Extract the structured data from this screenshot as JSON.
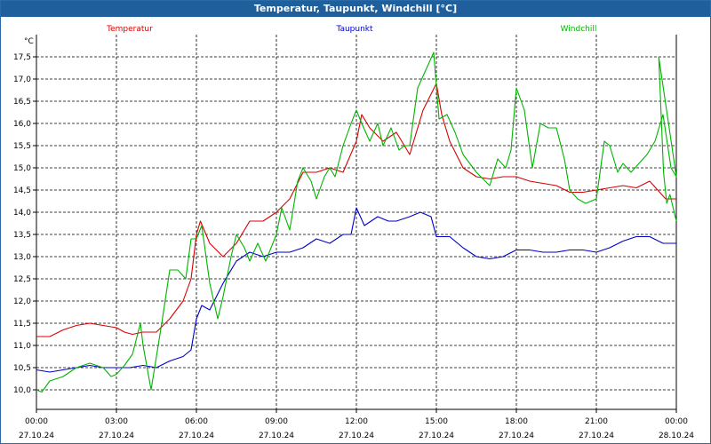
{
  "window": {
    "title": "Temperatur, Taupunkt, Windchill [°C]"
  },
  "chart_data": {
    "type": "line",
    "title": "Temperatur, Taupunkt, Windchill [°C]",
    "ylabel": "°C",
    "xlabel": "",
    "ylim": [
      9.6,
      18.0
    ],
    "xlim": [
      0,
      24
    ],
    "grid": true,
    "legend_placement": "top",
    "yticks": [
      10.0,
      10.5,
      11.0,
      11.5,
      12.0,
      12.5,
      13.0,
      13.5,
      14.0,
      14.5,
      15.0,
      15.5,
      16.0,
      16.5,
      17.0,
      17.5
    ],
    "ytick_labels": [
      "10,0",
      "10,5",
      "11,0",
      "11,5",
      "12,0",
      "12,5",
      "13,0",
      "13,5",
      "14,0",
      "14,5",
      "15,0",
      "15,5",
      "16,0",
      "16,5",
      "17,0",
      "17,5"
    ],
    "xticks": [
      {
        "x": 0,
        "time": "00:00",
        "date": "27.10.24"
      },
      {
        "x": 3,
        "time": "03:00",
        "date": "27.10.24"
      },
      {
        "x": 6,
        "time": "06:00",
        "date": "27.10.24"
      },
      {
        "x": 9,
        "time": "09:00",
        "date": "27.10.24"
      },
      {
        "x": 12,
        "time": "12:00",
        "date": "27.10.24"
      },
      {
        "x": 15,
        "time": "15:00",
        "date": "27.10.24"
      },
      {
        "x": 18,
        "time": "18:00",
        "date": "27.10.24"
      },
      {
        "x": 21,
        "time": "21:00",
        "date": "27.10.24"
      },
      {
        "x": 24,
        "time": "00:00",
        "date": "28.10.24"
      }
    ],
    "series": [
      {
        "name": "Temperatur",
        "color": "#d80000",
        "points": [
          [
            0,
            11.2
          ],
          [
            0.5,
            11.2
          ],
          [
            1,
            11.35
          ],
          [
            1.5,
            11.45
          ],
          [
            2,
            11.5
          ],
          [
            2.5,
            11.45
          ],
          [
            3,
            11.4
          ],
          [
            3.3,
            11.3
          ],
          [
            3.6,
            11.25
          ],
          [
            4,
            11.3
          ],
          [
            4.5,
            11.3
          ],
          [
            5,
            11.6
          ],
          [
            5.5,
            12.0
          ],
          [
            5.8,
            12.5
          ],
          [
            6,
            13.5
          ],
          [
            6.15,
            13.8
          ],
          [
            6.5,
            13.3
          ],
          [
            7,
            13.0
          ],
          [
            7.5,
            13.3
          ],
          [
            8,
            13.8
          ],
          [
            8.5,
            13.8
          ],
          [
            9,
            14.0
          ],
          [
            9.5,
            14.3
          ],
          [
            10,
            14.9
          ],
          [
            10.5,
            14.9
          ],
          [
            11,
            15.0
          ],
          [
            11.5,
            14.9
          ],
          [
            12,
            15.6
          ],
          [
            12.2,
            16.2
          ],
          [
            12.5,
            15.9
          ],
          [
            13,
            15.6
          ],
          [
            13.5,
            15.8
          ],
          [
            14,
            15.3
          ],
          [
            14.5,
            16.3
          ],
          [
            15,
            16.9
          ],
          [
            15.2,
            16.2
          ],
          [
            15.5,
            15.6
          ],
          [
            16,
            15.0
          ],
          [
            16.5,
            14.8
          ],
          [
            17,
            14.75
          ],
          [
            17.5,
            14.8
          ],
          [
            18,
            14.8
          ],
          [
            18.5,
            14.7
          ],
          [
            19,
            14.65
          ],
          [
            19.5,
            14.6
          ],
          [
            20,
            14.45
          ],
          [
            20.5,
            14.45
          ],
          [
            21,
            14.5
          ],
          [
            21.5,
            14.55
          ],
          [
            22,
            14.6
          ],
          [
            22.5,
            14.55
          ],
          [
            23,
            14.7
          ],
          [
            23.3,
            14.5
          ],
          [
            23.6,
            14.3
          ],
          [
            24,
            14.3
          ]
        ]
      },
      {
        "name": "Taupunkt",
        "color": "#0000c8",
        "points": [
          [
            0,
            10.45
          ],
          [
            0.5,
            10.4
          ],
          [
            1,
            10.45
          ],
          [
            1.5,
            10.5
          ],
          [
            2,
            10.55
          ],
          [
            2.5,
            10.5
          ],
          [
            3,
            10.5
          ],
          [
            3.5,
            10.5
          ],
          [
            4,
            10.55
          ],
          [
            4.5,
            10.5
          ],
          [
            5,
            10.65
          ],
          [
            5.5,
            10.75
          ],
          [
            5.8,
            10.9
          ],
          [
            6,
            11.6
          ],
          [
            6.2,
            11.9
          ],
          [
            6.5,
            11.8
          ],
          [
            7,
            12.4
          ],
          [
            7.5,
            12.9
          ],
          [
            8,
            13.1
          ],
          [
            8.5,
            13.0
          ],
          [
            9,
            13.1
          ],
          [
            9.5,
            13.1
          ],
          [
            10,
            13.2
          ],
          [
            10.5,
            13.4
          ],
          [
            11,
            13.3
          ],
          [
            11.5,
            13.5
          ],
          [
            11.8,
            13.5
          ],
          [
            12,
            14.1
          ],
          [
            12.3,
            13.7
          ],
          [
            12.8,
            13.9
          ],
          [
            13.2,
            13.8
          ],
          [
            13.5,
            13.8
          ],
          [
            14,
            13.9
          ],
          [
            14.4,
            14.0
          ],
          [
            14.8,
            13.9
          ],
          [
            15,
            13.45
          ],
          [
            15.5,
            13.45
          ],
          [
            16,
            13.2
          ],
          [
            16.5,
            13.0
          ],
          [
            17,
            12.95
          ],
          [
            17.5,
            13.0
          ],
          [
            18,
            13.15
          ],
          [
            18.5,
            13.15
          ],
          [
            19,
            13.1
          ],
          [
            19.5,
            13.1
          ],
          [
            20,
            13.15
          ],
          [
            20.5,
            13.15
          ],
          [
            21,
            13.1
          ],
          [
            21.5,
            13.2
          ],
          [
            22,
            13.35
          ],
          [
            22.5,
            13.45
          ],
          [
            23,
            13.45
          ],
          [
            23.5,
            13.3
          ],
          [
            24,
            13.3
          ]
        ]
      },
      {
        "name": "Windchill",
        "color": "#00b400",
        "points": [
          [
            0,
            10.0
          ],
          [
            0.2,
            9.95
          ],
          [
            0.5,
            10.2
          ],
          [
            1,
            10.3
          ],
          [
            1.5,
            10.5
          ],
          [
            2,
            10.6
          ],
          [
            2.5,
            10.5
          ],
          [
            2.8,
            10.3
          ],
          [
            3,
            10.35
          ],
          [
            3.3,
            10.55
          ],
          [
            3.6,
            10.8
          ],
          [
            3.9,
            11.5
          ],
          [
            4,
            11.0
          ],
          [
            4.3,
            10.0
          ],
          [
            4.7,
            11.5
          ],
          [
            5,
            12.7
          ],
          [
            5.3,
            12.7
          ],
          [
            5.6,
            12.5
          ],
          [
            5.8,
            13.4
          ],
          [
            6,
            13.4
          ],
          [
            6.2,
            13.7
          ],
          [
            6.5,
            12.4
          ],
          [
            6.8,
            11.6
          ],
          [
            7,
            12.1
          ],
          [
            7.3,
            13.0
          ],
          [
            7.5,
            13.5
          ],
          [
            7.8,
            13.2
          ],
          [
            8,
            12.9
          ],
          [
            8.3,
            13.3
          ],
          [
            8.6,
            12.9
          ],
          [
            9,
            13.5
          ],
          [
            9.2,
            14.1
          ],
          [
            9.5,
            13.6
          ],
          [
            9.8,
            14.7
          ],
          [
            10,
            15.0
          ],
          [
            10.3,
            14.7
          ],
          [
            10.5,
            14.3
          ],
          [
            10.8,
            14.8
          ],
          [
            11,
            15.0
          ],
          [
            11.2,
            14.8
          ],
          [
            11.5,
            15.5
          ],
          [
            11.8,
            16.0
          ],
          [
            12,
            16.3
          ],
          [
            12.2,
            16.0
          ],
          [
            12.5,
            15.6
          ],
          [
            12.8,
            16.0
          ],
          [
            13,
            15.5
          ],
          [
            13.3,
            15.9
          ],
          [
            13.6,
            15.4
          ],
          [
            13.8,
            15.5
          ],
          [
            14,
            15.5
          ],
          [
            14.3,
            16.8
          ],
          [
            14.6,
            17.2
          ],
          [
            14.9,
            17.6
          ],
          [
            15.1,
            16.1
          ],
          [
            15.4,
            16.2
          ],
          [
            15.7,
            15.8
          ],
          [
            16,
            15.3
          ],
          [
            16.5,
            14.9
          ],
          [
            17,
            14.6
          ],
          [
            17.3,
            15.2
          ],
          [
            17.6,
            15.0
          ],
          [
            17.8,
            15.4
          ],
          [
            18,
            16.8
          ],
          [
            18.3,
            16.3
          ],
          [
            18.6,
            15.0
          ],
          [
            18.9,
            16.0
          ],
          [
            19.2,
            15.9
          ],
          [
            19.5,
            15.9
          ],
          [
            19.8,
            15.2
          ],
          [
            20,
            14.5
          ],
          [
            20.3,
            14.3
          ],
          [
            20.6,
            14.2
          ],
          [
            21,
            14.3
          ],
          [
            21.3,
            15.6
          ],
          [
            21.5,
            15.5
          ],
          [
            21.8,
            14.9
          ],
          [
            22,
            15.1
          ],
          [
            22.3,
            14.9
          ],
          [
            22.6,
            15.1
          ],
          [
            22.9,
            15.3
          ],
          [
            23.2,
            15.6
          ],
          [
            23.5,
            16.2
          ],
          [
            23.8,
            15.0
          ],
          [
            24.0,
            14.8
          ],
          [
            24.2,
            17.5
          ],
          [
            24.5,
            14.9
          ],
          [
            24.7,
            14.2
          ],
          [
            24.9,
            14.4
          ],
          [
            25.1,
            14.1
          ],
          [
            25.3,
            13.8
          ]
        ]
      }
    ]
  }
}
